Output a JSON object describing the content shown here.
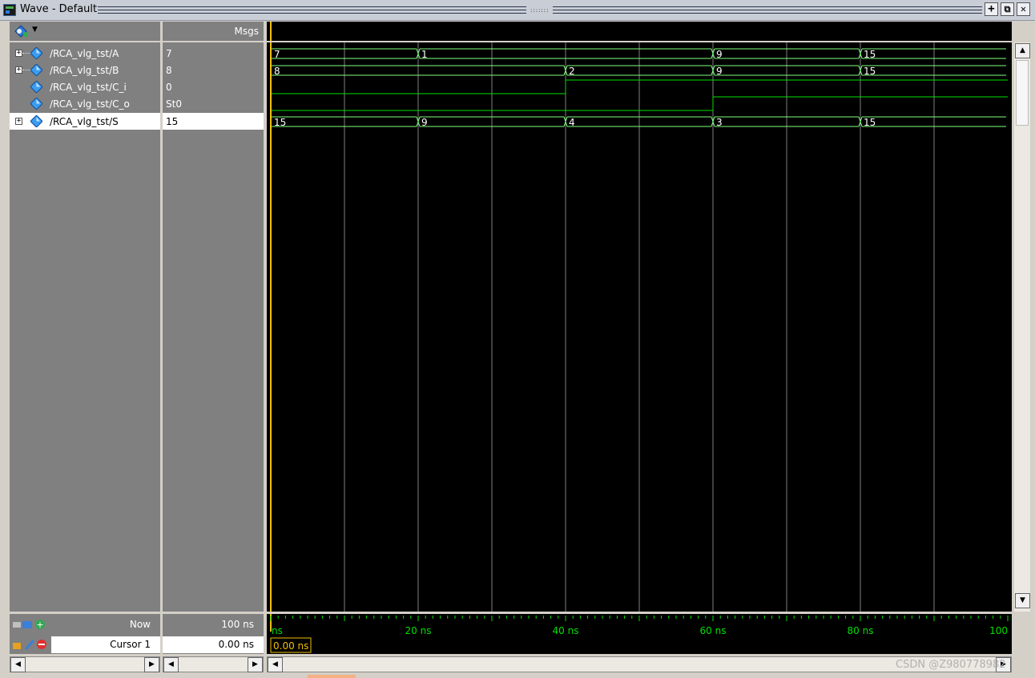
{
  "window": {
    "title": "Wave - Default",
    "grip": ":::::::",
    "buttons": {
      "dock": "+",
      "undock": "⧉",
      "close": "✕"
    }
  },
  "header": {
    "values_label": "Msgs",
    "add_icon": "signal-add-icon",
    "dropdown_icon": "chevron-down-icon"
  },
  "signals": [
    {
      "name": "/RCA_vlg_tst/A",
      "value": "7",
      "expandable": true
    },
    {
      "name": "/RCA_vlg_tst/B",
      "value": "8",
      "expandable": true
    },
    {
      "name": "/RCA_vlg_tst/C_i",
      "value": "0",
      "expandable": false
    },
    {
      "name": "/RCA_vlg_tst/C_o",
      "value": "St0",
      "expandable": false
    },
    {
      "name": "/RCA_vlg_tst/S",
      "value": "15",
      "expandable": true,
      "selected": true
    }
  ],
  "waveform": {
    "time_max_ns": 100,
    "bus_segments": {
      "A": [
        {
          "start": 0,
          "label": "7"
        },
        {
          "start": 20,
          "label": "1"
        },
        {
          "start": 60,
          "label": "9"
        },
        {
          "start": 80,
          "label": "15"
        }
      ],
      "B": [
        {
          "start": 0,
          "label": "8"
        },
        {
          "start": 40,
          "label": "2"
        },
        {
          "start": 60,
          "label": "9"
        },
        {
          "start": 80,
          "label": "15"
        }
      ],
      "S": [
        {
          "start": 0,
          "label": "15"
        },
        {
          "start": 20,
          "label": "9"
        },
        {
          "start": 40,
          "label": "4"
        },
        {
          "start": 60,
          "label": "3"
        },
        {
          "start": 80,
          "label": "15"
        }
      ]
    },
    "bit_signals": {
      "C_i": [
        {
          "t": 0,
          "v": 0
        },
        {
          "t": 40,
          "v": 1
        }
      ],
      "C_o": [
        {
          "t": 0,
          "v": 0
        },
        {
          "t": 60,
          "v": 1
        }
      ]
    },
    "cursor_time_ns": 0,
    "colors": {
      "bus": "#7fff7f",
      "bit": "#00e000",
      "grid": "#7f7f7f",
      "cursor": "#f0c000",
      "ruler": "#00e000"
    }
  },
  "timeline": {
    "labels": [
      "ns",
      "20 ns",
      "40 ns",
      "60 ns",
      "80 ns",
      "100"
    ],
    "cursor_readout": "0.00 ns"
  },
  "status": {
    "now_label": "Now",
    "now_value": "100 ns",
    "cursor_label": "Cursor 1",
    "cursor_value": "0.00 ns"
  },
  "watermark": "CSDN @Z980778982"
}
